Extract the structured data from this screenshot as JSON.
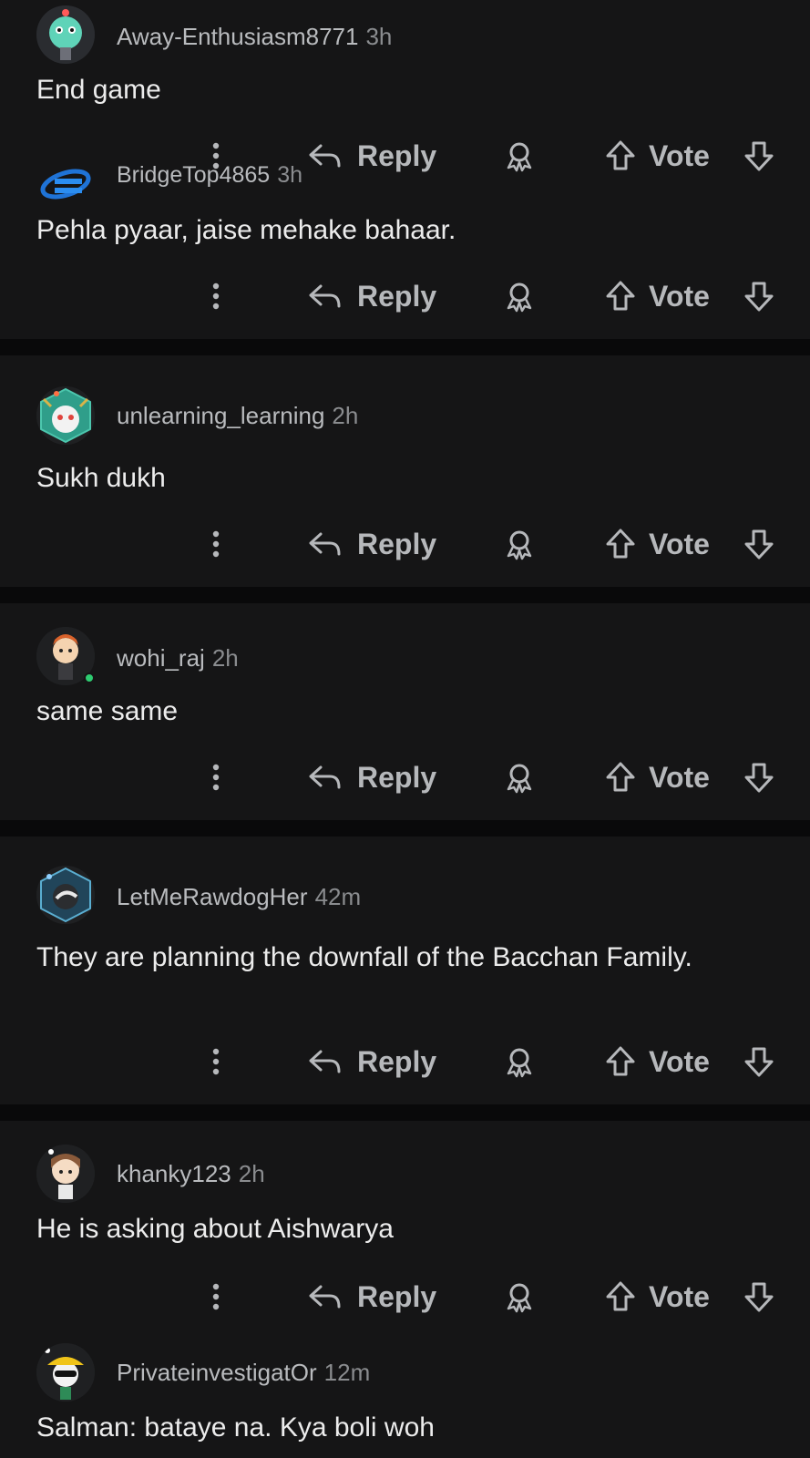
{
  "labels": {
    "reply": "Reply",
    "vote": "Vote"
  },
  "icons": [
    "more-vertical-icon",
    "reply-arrow-icon",
    "award-icon",
    "upvote-arrow-icon",
    "downvote-arrow-icon"
  ],
  "colors": {
    "background": "#101011",
    "card": "#151516",
    "action_text": "#b6b8bb",
    "online": "#2ecc71"
  },
  "comments": [
    {
      "user": "Away-Enthusiasm8771",
      "time": "3h",
      "text": "End game"
    },
    {
      "user": "BridgeTop4865",
      "time": "3h",
      "text": "Pehla pyaar, jaise mehake bahaar."
    },
    {
      "user": "unlearning_learning",
      "time": "2h",
      "text": "Sukh dukh"
    },
    {
      "user": "wohi_raj",
      "time": "2h",
      "text": "same same"
    },
    {
      "user": "LetMeRawdogHer",
      "time": "42m",
      "text": "They are planning the downfall of the Bacchan Family."
    },
    {
      "user": "khanky123",
      "time": "2h",
      "text": "He is asking about Aishwarya"
    },
    {
      "user": "PrivateinvestigatOr",
      "time": "12m",
      "text": "Salman: bataye na. Kya boli woh"
    }
  ]
}
